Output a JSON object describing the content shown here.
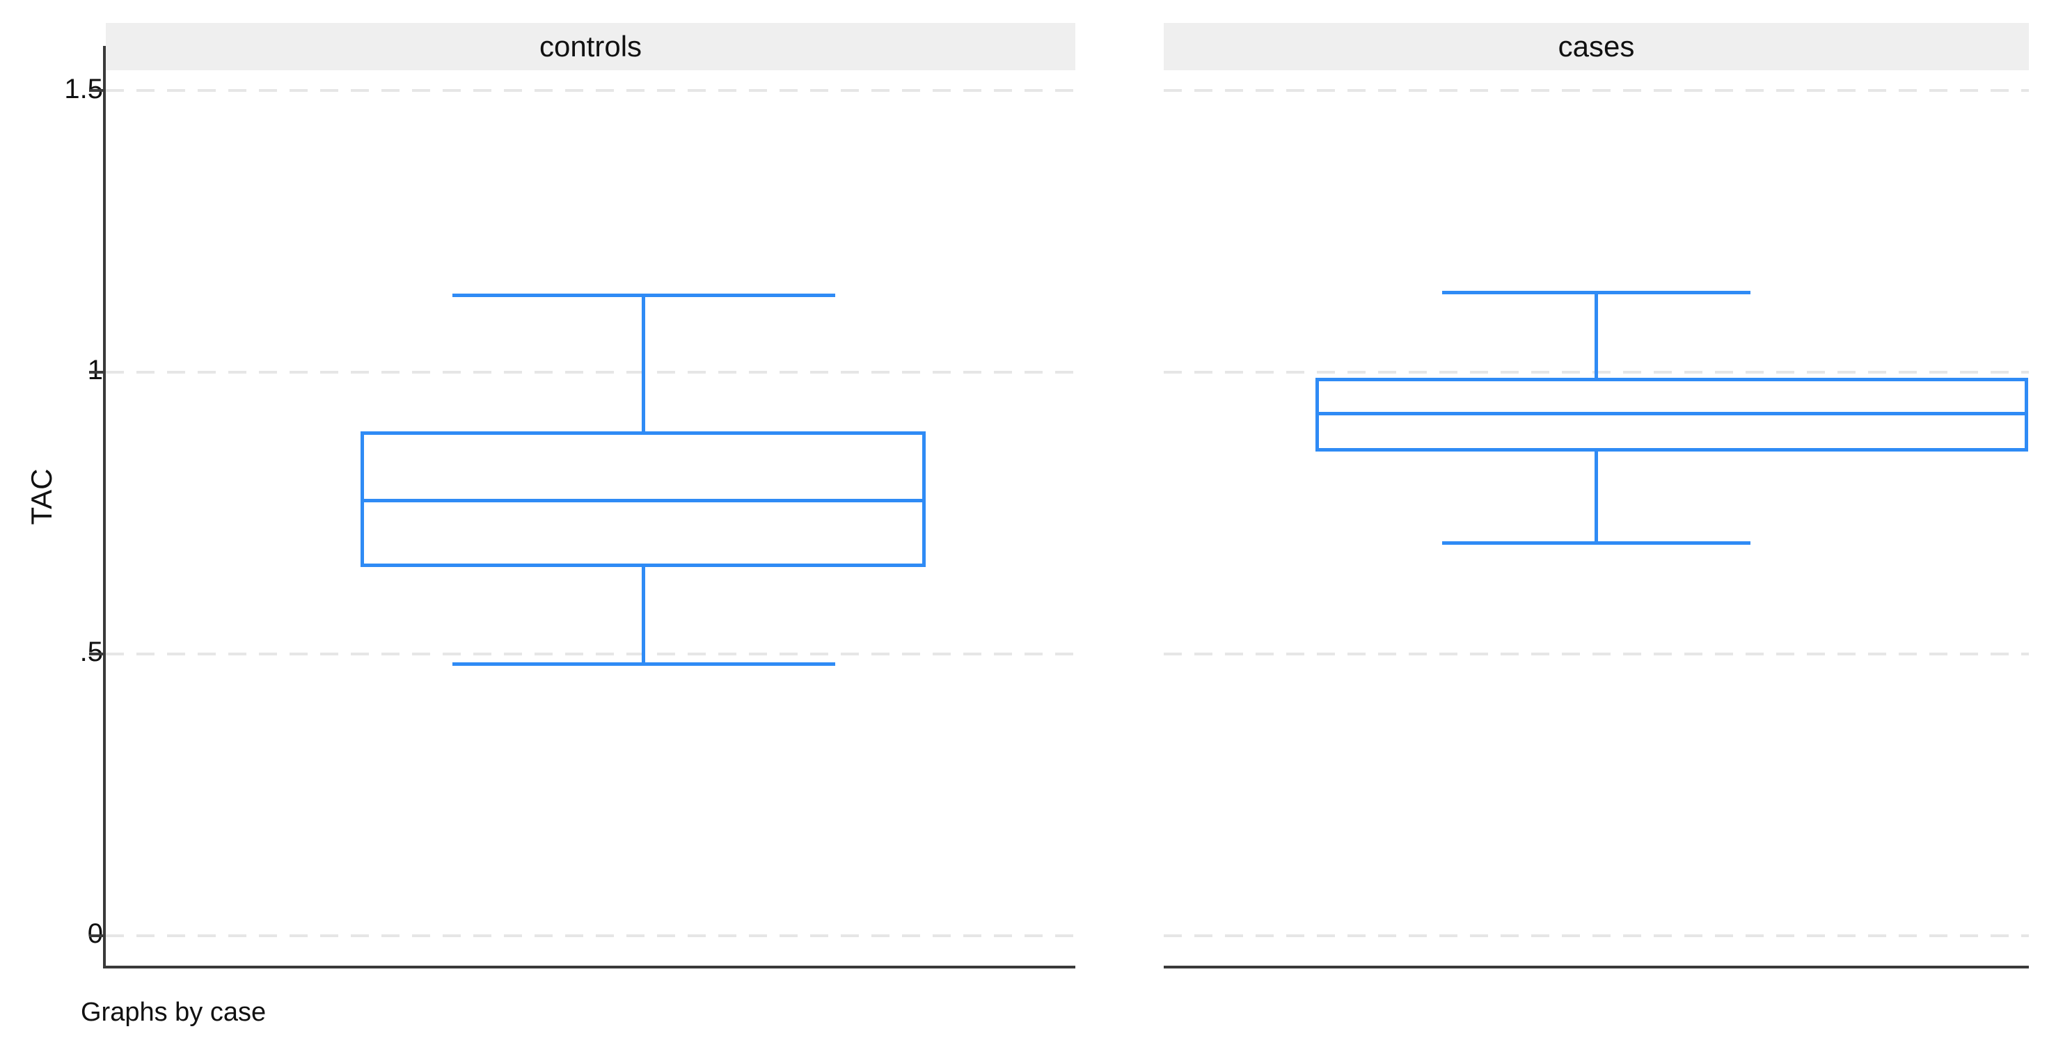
{
  "axis": {
    "y_title": "TAC",
    "y_ticks": [
      {
        "label": "1.5",
        "value": 1.5
      },
      {
        "label": "1",
        "value": 1.0
      },
      {
        "label": ".5",
        "value": 0.5
      },
      {
        "label": "0",
        "value": 0.0
      }
    ]
  },
  "panels": [
    {
      "id": "controls",
      "title": "controls"
    },
    {
      "id": "cases",
      "title": "cases"
    }
  ],
  "caption": "Graphs by case",
  "colors": {
    "box_stroke": "#2f8bf5",
    "panel_header_bg": "#efefef",
    "gridline": "#e6e6e6",
    "axis_line": "#3a3a3a",
    "text": "#111111",
    "background": "#ffffff"
  },
  "chart_data": {
    "type": "box",
    "title": "",
    "subtitle": "",
    "xlabel": "",
    "ylabel": "TAC",
    "ylim": [
      0,
      1.58
    ],
    "yticks": [
      0,
      0.5,
      1,
      1.5
    ],
    "ytick_labels": [
      "0",
      ".5",
      "1",
      "1.5"
    ],
    "grid": true,
    "grid_axis": "y",
    "legend": "none",
    "orientation": "vertical",
    "faceted_by": "case",
    "facet_labels": [
      "controls",
      "cases"
    ],
    "caption": "Graphs by case",
    "series": [
      {
        "name": "controls",
        "whisker_low": 0.485,
        "q1": 0.655,
        "median": 0.775,
        "q3": 0.895,
        "whisker_high": 1.14,
        "outliers": []
      },
      {
        "name": "cases",
        "whisker_low": 0.7,
        "q1": 0.86,
        "median": 0.93,
        "q3": 0.99,
        "whisker_high": 1.145,
        "outliers": []
      }
    ]
  }
}
